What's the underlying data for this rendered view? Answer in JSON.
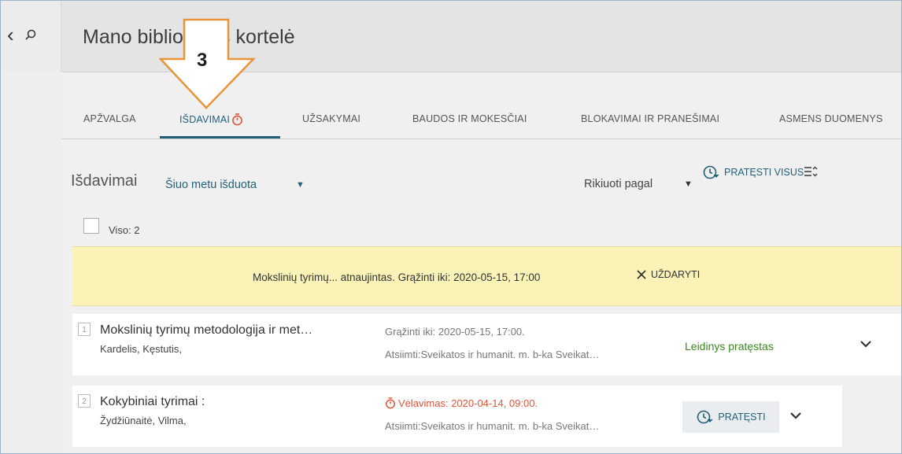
{
  "header": {
    "title": "Mano bibliotekos kortelė"
  },
  "tabs": [
    {
      "label": "APŽVALGA"
    },
    {
      "label": "IŠDAVIMAI"
    },
    {
      "label": "UŽSAKYMAI"
    },
    {
      "label": "BAUDOS IR MOKESČIAI"
    },
    {
      "label": "BLOKAVIMAI IR PRANEŠIMAI"
    },
    {
      "label": "ASMENS DUOMENYS"
    }
  ],
  "section": {
    "title": "Išdavimai",
    "filter": "Šiuo metu išduota",
    "sort_label": "Rikiuoti pagal",
    "renew_all": "PRATĘSTI VISUS",
    "count": "Viso: 2"
  },
  "banner": {
    "message": "Mokslinių tyrimų... atnaujintas. Grąžinti iki: 2020-05-15, 17:00",
    "close": "UŽDARYTI"
  },
  "loans": [
    {
      "num": "1",
      "title": "Mokslinių tyrimų metodologija ir met…",
      "author": "Kardelis, Kęstutis,",
      "due": "Grąžinti iki: 2020-05-15, 17:00.",
      "pickup": "Atsiimti:Sveikatos ir humanit. m. b-ka Sveikat…",
      "status": "Leidinys pratęstas"
    },
    {
      "num": "2",
      "title": "Kokybiniai tyrimai :",
      "author": "Žydžiūnaitė, Vilma,",
      "due": "Vėlavimas: 2020-04-14, 09:00.",
      "pickup": "Atsiimti:Sveikatos ir humanit. m. b-ka Sveikat…",
      "renew": "PRATĘSTI"
    }
  ],
  "callout": {
    "number": "3"
  },
  "colors": {
    "accent": "#22607a",
    "overdue": "#e1553a",
    "renewed": "#3a8a1e",
    "banner": "#fbf2b8",
    "callout": "#e8943a"
  }
}
